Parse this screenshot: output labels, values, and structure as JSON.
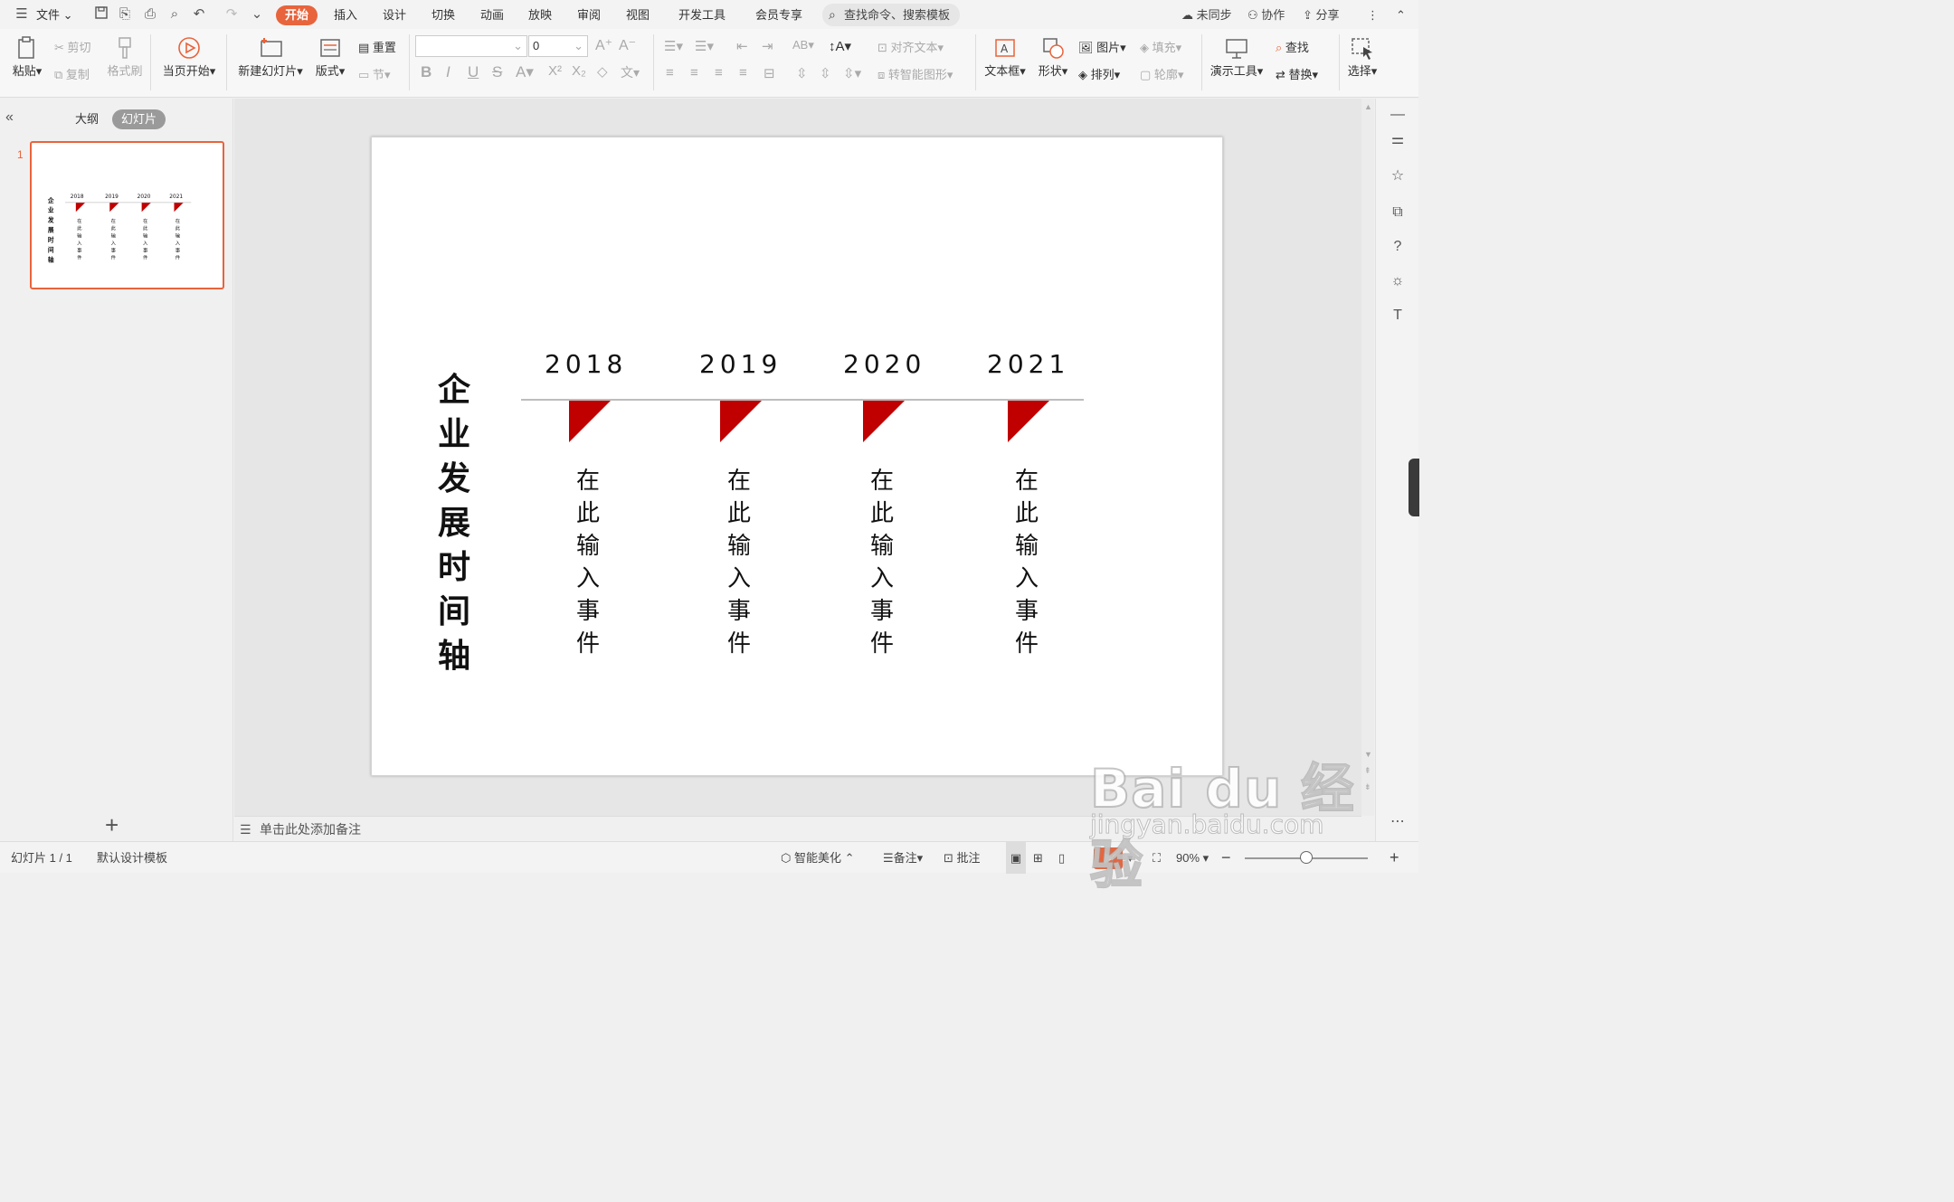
{
  "menubar": {
    "file_label": "文件",
    "tabs": [
      {
        "label": "开始",
        "active": true
      },
      {
        "label": "插入"
      },
      {
        "label": "设计"
      },
      {
        "label": "切换"
      },
      {
        "label": "动画"
      },
      {
        "label": "放映"
      },
      {
        "label": "审阅"
      },
      {
        "label": "视图"
      },
      {
        "label": "开发工具"
      },
      {
        "label": "会员专享"
      }
    ],
    "search_placeholder": "查找命令、搜索模板",
    "sync_label": "未同步",
    "collab_label": "协作",
    "share_label": "分享"
  },
  "ribbon": {
    "paste": "粘贴",
    "cut": "剪切",
    "copy": "复制",
    "format_painter": "格式刷",
    "from_current": "当页开始",
    "new_slide": "新建幻灯片",
    "layout": "版式",
    "reset": "重置",
    "section": "节",
    "font_size": "0",
    "align_text": "对齐文本",
    "smart_art": "转智能图形",
    "textbox": "文本框",
    "shape": "形状",
    "picture": "图片",
    "fill": "填充",
    "arrange": "排列",
    "outline": "轮廓",
    "presentation_tools": "演示工具",
    "find": "查找",
    "replace": "替换",
    "select": "选择"
  },
  "left_panel": {
    "tab_outline": "大纲",
    "tab_slides": "幻灯片",
    "slide_number": "1"
  },
  "slide": {
    "title_chars": [
      "企",
      "业",
      "发",
      "展",
      "时",
      "间",
      "轴"
    ],
    "years": [
      "2018",
      "2019",
      "2020",
      "2021"
    ],
    "event_chars": [
      "在",
      "此",
      "输",
      "入",
      "事",
      "件"
    ],
    "accent_color": "#c00000"
  },
  "notes": {
    "placeholder": "单击此处添加备注"
  },
  "statusbar": {
    "slide_info": "幻灯片 1 / 1",
    "template": "默认设计模板",
    "beautify": "智能美化",
    "notes": "备注",
    "comment": "批注",
    "zoom": "90%",
    "zoom_level": 0.5
  },
  "watermark": {
    "brand": "Bai du 经验",
    "url": "jingyan.baidu.com"
  }
}
